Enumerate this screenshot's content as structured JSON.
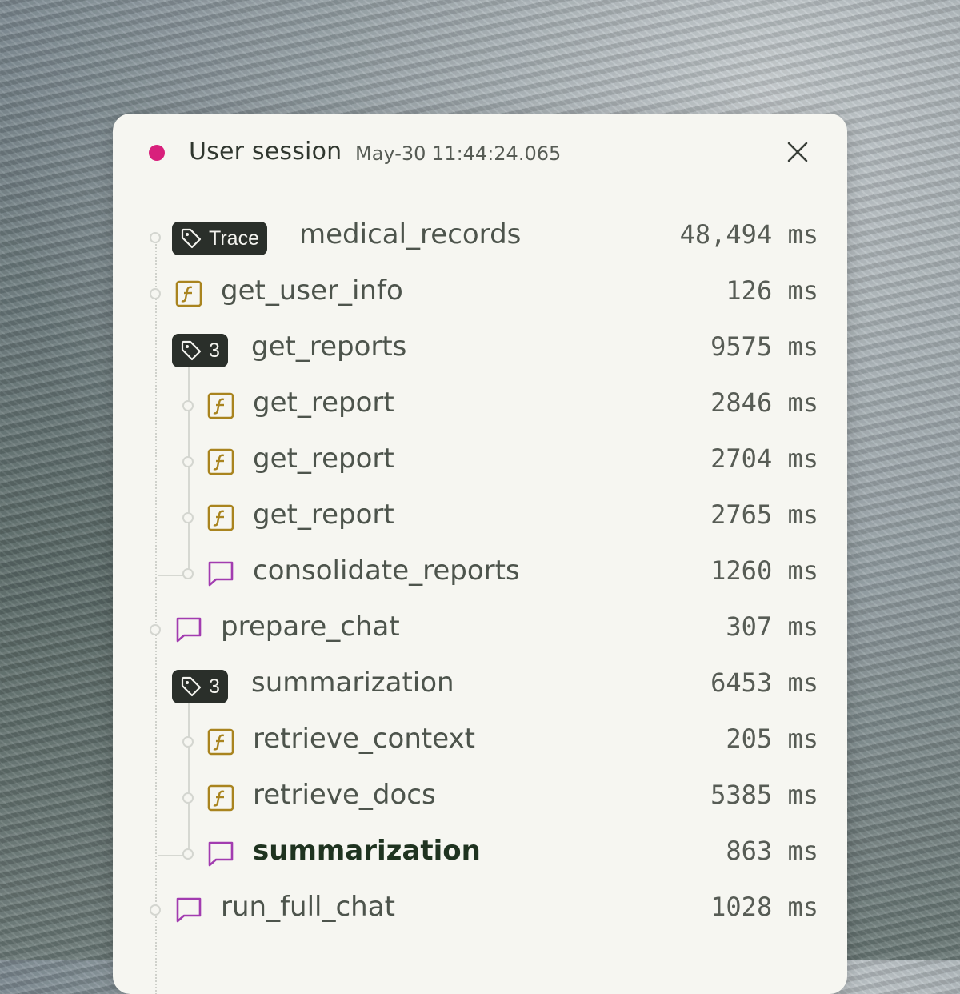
{
  "header": {
    "title": "User session",
    "timestamp": "May-30 11:44:24.065",
    "status_color": "#d8207c",
    "close_icon": "close-icon"
  },
  "colors": {
    "function_icon": "#a9841f",
    "chat_icon": "#a23cb0",
    "badge_bg": "#2a2f2a"
  },
  "rows": [
    {
      "kind": "trace",
      "badge": "Trace",
      "label": "medical_records",
      "duration": "48,494 ms"
    },
    {
      "kind": "function",
      "label": "get_user_info",
      "duration": "126 ms"
    },
    {
      "kind": "group",
      "badge": "3",
      "label": "get_reports",
      "duration": "9575 ms"
    },
    {
      "kind": "function",
      "label": "get_report",
      "duration": "2846 ms"
    },
    {
      "kind": "function",
      "label": "get_report",
      "duration": "2704 ms"
    },
    {
      "kind": "function",
      "label": "get_report",
      "duration": "2765 ms"
    },
    {
      "kind": "chat",
      "label": "consolidate_reports",
      "duration": "1260 ms"
    },
    {
      "kind": "chat",
      "label": "prepare_chat",
      "duration": "307 ms"
    },
    {
      "kind": "group",
      "badge": "3",
      "label": "summarization",
      "duration": "6453 ms"
    },
    {
      "kind": "function",
      "label": "retrieve_context",
      "duration": "205 ms"
    },
    {
      "kind": "function",
      "label": "retrieve_docs",
      "duration": "5385 ms"
    },
    {
      "kind": "chat",
      "label": "summarization",
      "duration": "863 ms"
    },
    {
      "kind": "chat",
      "label": "run_full_chat",
      "duration": "1028 ms"
    }
  ]
}
